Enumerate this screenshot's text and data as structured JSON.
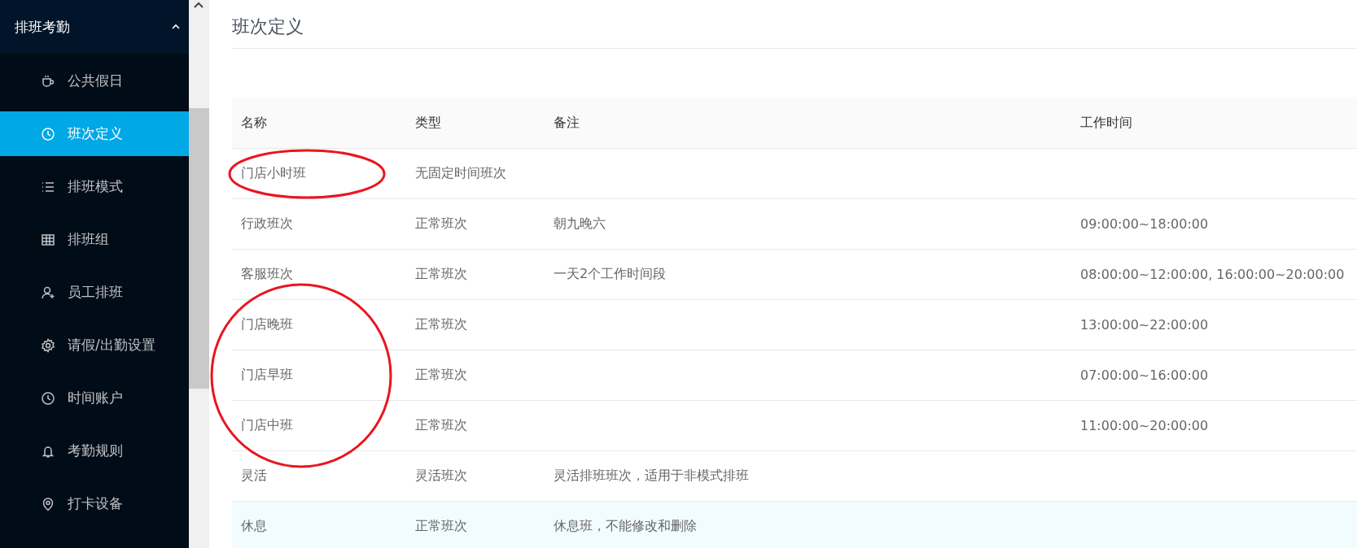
{
  "sidebar": {
    "group": {
      "label": "排班考勤",
      "expanded": true
    },
    "items": [
      {
        "label": "公共假日",
        "selected": false
      },
      {
        "label": "班次定义",
        "selected": true
      },
      {
        "label": "排班模式",
        "selected": false
      },
      {
        "label": "排班组",
        "selected": false
      },
      {
        "label": "员工排班",
        "selected": false
      },
      {
        "label": "请假/出勤设置",
        "selected": false
      },
      {
        "label": "时间账户",
        "selected": false
      },
      {
        "label": "考勤规则",
        "selected": false
      },
      {
        "label": "打卡设备",
        "selected": false
      }
    ]
  },
  "page": {
    "title": "班次定义"
  },
  "table": {
    "columns": [
      "名称",
      "类型",
      "备注",
      "工作时间"
    ],
    "rows": [
      {
        "cells": [
          "门店小时班",
          "无固定时间班次",
          "",
          ""
        ],
        "circled": true,
        "highlighted": false
      },
      {
        "cells": [
          "行政班次",
          "正常班次",
          "朝九晚六",
          "09:00:00~18:00:00"
        ],
        "circled": false,
        "highlighted": false
      },
      {
        "cells": [
          "客服班次",
          "正常班次",
          "一天2个工作时间段",
          "08:00:00~12:00:00, 16:00:00~20:00:00"
        ],
        "circled": false,
        "highlighted": false
      },
      {
        "cells": [
          "门店晚班",
          "正常班次",
          "",
          "13:00:00~22:00:00"
        ],
        "circled": true,
        "highlighted": false
      },
      {
        "cells": [
          "门店早班",
          "正常班次",
          "",
          "07:00:00~16:00:00"
        ],
        "circled": true,
        "highlighted": false
      },
      {
        "cells": [
          "门店中班",
          "正常班次",
          "",
          "11:00:00~20:00:00"
        ],
        "circled": true,
        "highlighted": false
      },
      {
        "cells": [
          "灵活",
          "灵活班次",
          "灵活排班班次，适用于非模式排班",
          ""
        ],
        "circled": false,
        "highlighted": false
      },
      {
        "cells": [
          "休息",
          "正常班次",
          "休息班，不能修改和删除",
          ""
        ],
        "circled": false,
        "highlighted": true
      }
    ]
  }
}
